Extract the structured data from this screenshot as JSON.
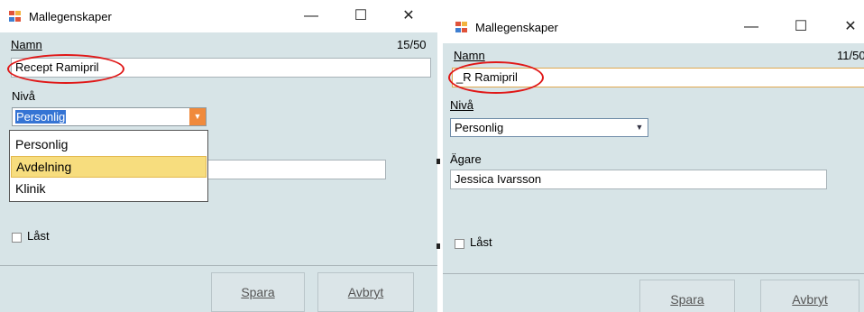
{
  "left": {
    "title": "Mallegenskaper",
    "caption": {
      "minimize": "—",
      "maximize": "☐",
      "close": "✕"
    },
    "namn_label": "Namn",
    "counter": "15/50",
    "namn_value": "Recept Ramipril",
    "niva_label": "Nivå",
    "niva_selected": "Personlig",
    "dropdown_options": [
      "Personlig",
      "Avdelning",
      "Klinik"
    ],
    "dropdown_highlighted": "Avdelning",
    "last_label": "Låst",
    "save_button": "Spara",
    "cancel_button": "Avbryt"
  },
  "right": {
    "title": "Mallegenskaper",
    "caption": {
      "minimize": "—",
      "maximize": "☐",
      "close": "✕"
    },
    "namn_label": "Namn",
    "counter": "11/50",
    "namn_value": "_R Ramipril",
    "niva_label": "Nivå",
    "niva_selected": "Personlig",
    "agare_label": "Ägare",
    "agare_value": "Jessica Ivarsson",
    "last_label": "Låst",
    "save_button": "Spara",
    "cancel_button": "Avbryt"
  },
  "annotation": {
    "ring_color": "#e01818"
  }
}
